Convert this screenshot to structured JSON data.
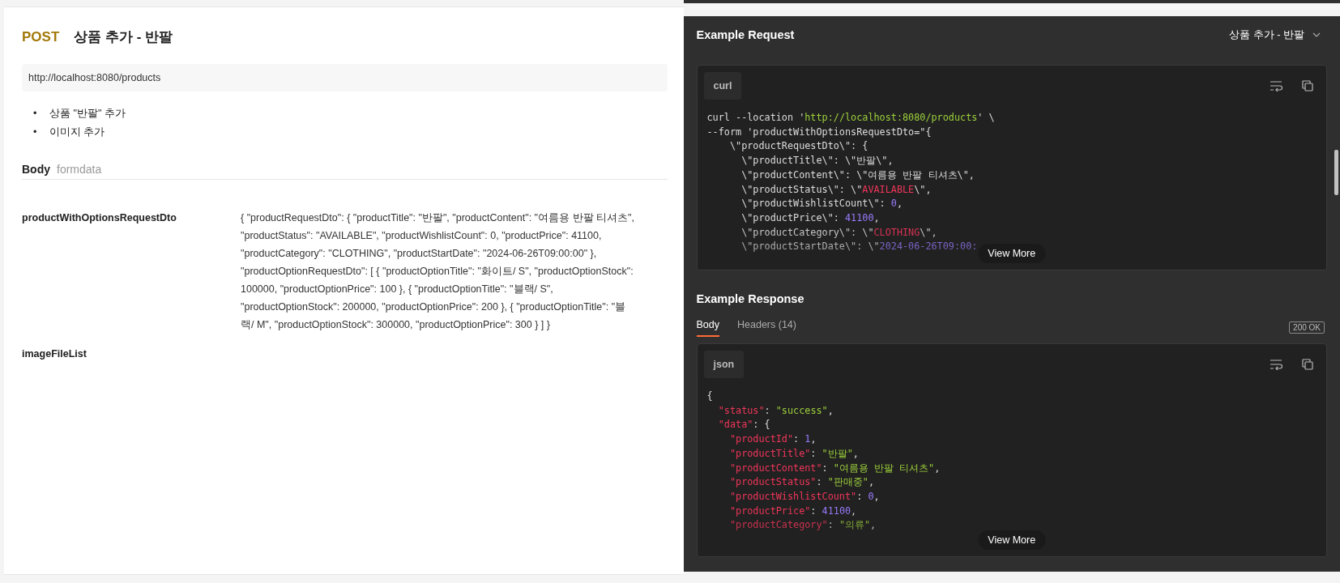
{
  "endpoint": {
    "method": "POST",
    "name": "상품 추가 - 반팔",
    "url": "http://localhost:8080/products",
    "notes": [
      {
        "marker": "•",
        "text": "상품 \"반팔\" 추가"
      },
      {
        "marker": "•",
        "text": "이미지 추가"
      }
    ]
  },
  "body": {
    "title": "Body",
    "type": "formdata",
    "params": [
      {
        "key": "productWithOptionsRequestDto",
        "value": "{ \"productRequestDto\": { \"productTitle\": \"반팔\", \"productContent\": \"여름용 반팔 티셔츠\", \"productStatus\": \"AVAILABLE\", \"productWishlistCount\": 0, \"productPrice\": 41100, \"productCategory\": \"CLOTHING\", \"productStartDate\": \"2024-06-26T09:00:00\" }, \"productOptionRequestDto\": [ { \"productOptionTitle\": \"화이트/ S\", \"productOptionStock\": 100000, \"productOptionPrice\": 100 }, { \"productOptionTitle\": \"블랙/ S\", \"productOptionStock\": 200000, \"productOptionPrice\": 200 }, { \"productOptionTitle\": \"블랙/ M\", \"productOptionStock\": 300000, \"productOptionPrice\": 300 } ] }"
      },
      {
        "key": "imageFileList"
      }
    ]
  },
  "example_request": {
    "title": "Example Request",
    "selector": "상품 추가 - 반팔",
    "language": "curl",
    "view_more": "View More",
    "code": [
      [
        {
          "kind": "plain",
          "text": "curl --location '"
        },
        {
          "kind": "string",
          "text": "http://localhost:8080/products"
        },
        {
          "kind": "plain",
          "text": "' \\"
        }
      ],
      [
        {
          "kind": "plain",
          "text": "--form 'productWithOptionsRequestDto=\"{"
        }
      ],
      [
        {
          "kind": "plain",
          "text": "    \\\"productRequestDto\\\": {"
        }
      ],
      [
        {
          "kind": "plain",
          "text": "      \\\"productTitle\\\": \\\"반팔\\\","
        }
      ],
      [
        {
          "kind": "plain",
          "text": "      \\\"productContent\\\": \\\"여름용 반팔 티셔츠\\\","
        }
      ],
      [
        {
          "kind": "plain",
          "text": "      \\\"productStatus\\\": \\\""
        },
        {
          "kind": "keyword",
          "text": "AVAILABLE"
        },
        {
          "kind": "plain",
          "text": "\\\","
        }
      ],
      [
        {
          "kind": "plain",
          "text": "      \\\"productWishlistCount\\\": "
        },
        {
          "kind": "number",
          "text": "0"
        },
        {
          "kind": "plain",
          "text": ","
        }
      ],
      [
        {
          "kind": "plain",
          "text": "      \\\"productPrice\\\": "
        },
        {
          "kind": "number",
          "text": "41100"
        },
        {
          "kind": "plain",
          "text": ","
        }
      ],
      [
        {
          "kind": "plain",
          "text": "      \\\"productCategory\\\": \\\""
        },
        {
          "kind": "keyword",
          "text": "CLOTHING"
        },
        {
          "kind": "plain",
          "text": "\\\","
        }
      ],
      [
        {
          "kind": "plain",
          "text": "      \\\"productStartDate\\\": \\\""
        },
        {
          "kind": "number",
          "text": "2024-06-26T09:00:"
        }
      ]
    ]
  },
  "example_response": {
    "title": "Example Response",
    "tabs": [
      {
        "label": "Body",
        "selected": true
      },
      {
        "label": "Headers (14)",
        "selected": false
      }
    ],
    "status": "200 OK",
    "language": "json",
    "view_more": "View More",
    "code": [
      [
        {
          "kind": "plain",
          "text": "{"
        }
      ],
      [
        {
          "kind": "keyword",
          "text": "  \"status\""
        },
        {
          "kind": "plain",
          "text": ": "
        },
        {
          "kind": "string",
          "text": "\"success\""
        },
        {
          "kind": "plain",
          "text": ","
        }
      ],
      [
        {
          "kind": "keyword",
          "text": "  \"data\""
        },
        {
          "kind": "plain",
          "text": ": {"
        }
      ],
      [
        {
          "kind": "keyword",
          "text": "    \"productId\""
        },
        {
          "kind": "plain",
          "text": ": "
        },
        {
          "kind": "number",
          "text": "1"
        },
        {
          "kind": "plain",
          "text": ","
        }
      ],
      [
        {
          "kind": "keyword",
          "text": "    \"productTitle\""
        },
        {
          "kind": "plain",
          "text": ": "
        },
        {
          "kind": "string",
          "text": "\"반팔\""
        },
        {
          "kind": "plain",
          "text": ","
        }
      ],
      [
        {
          "kind": "keyword",
          "text": "    \"productContent\""
        },
        {
          "kind": "plain",
          "text": ": "
        },
        {
          "kind": "string",
          "text": "\"여름용 반팔 티셔츠\""
        },
        {
          "kind": "plain",
          "text": ","
        }
      ],
      [
        {
          "kind": "keyword",
          "text": "    \"productStatus\""
        },
        {
          "kind": "plain",
          "text": ": "
        },
        {
          "kind": "string",
          "text": "\"판매중\""
        },
        {
          "kind": "plain",
          "text": ","
        }
      ],
      [
        {
          "kind": "keyword",
          "text": "    \"productWishlistCount\""
        },
        {
          "kind": "plain",
          "text": ": "
        },
        {
          "kind": "number",
          "text": "0"
        },
        {
          "kind": "plain",
          "text": ","
        }
      ],
      [
        {
          "kind": "keyword",
          "text": "    \"productPrice\""
        },
        {
          "kind": "plain",
          "text": ": "
        },
        {
          "kind": "number",
          "text": "41100"
        },
        {
          "kind": "plain",
          "text": ","
        }
      ],
      [
        {
          "kind": "keyword",
          "text": "    \"productCategory\""
        },
        {
          "kind": "plain",
          "text": ": "
        },
        {
          "kind": "string",
          "text": "\"의류\""
        },
        {
          "kind": "plain",
          "text": ","
        }
      ]
    ]
  }
}
